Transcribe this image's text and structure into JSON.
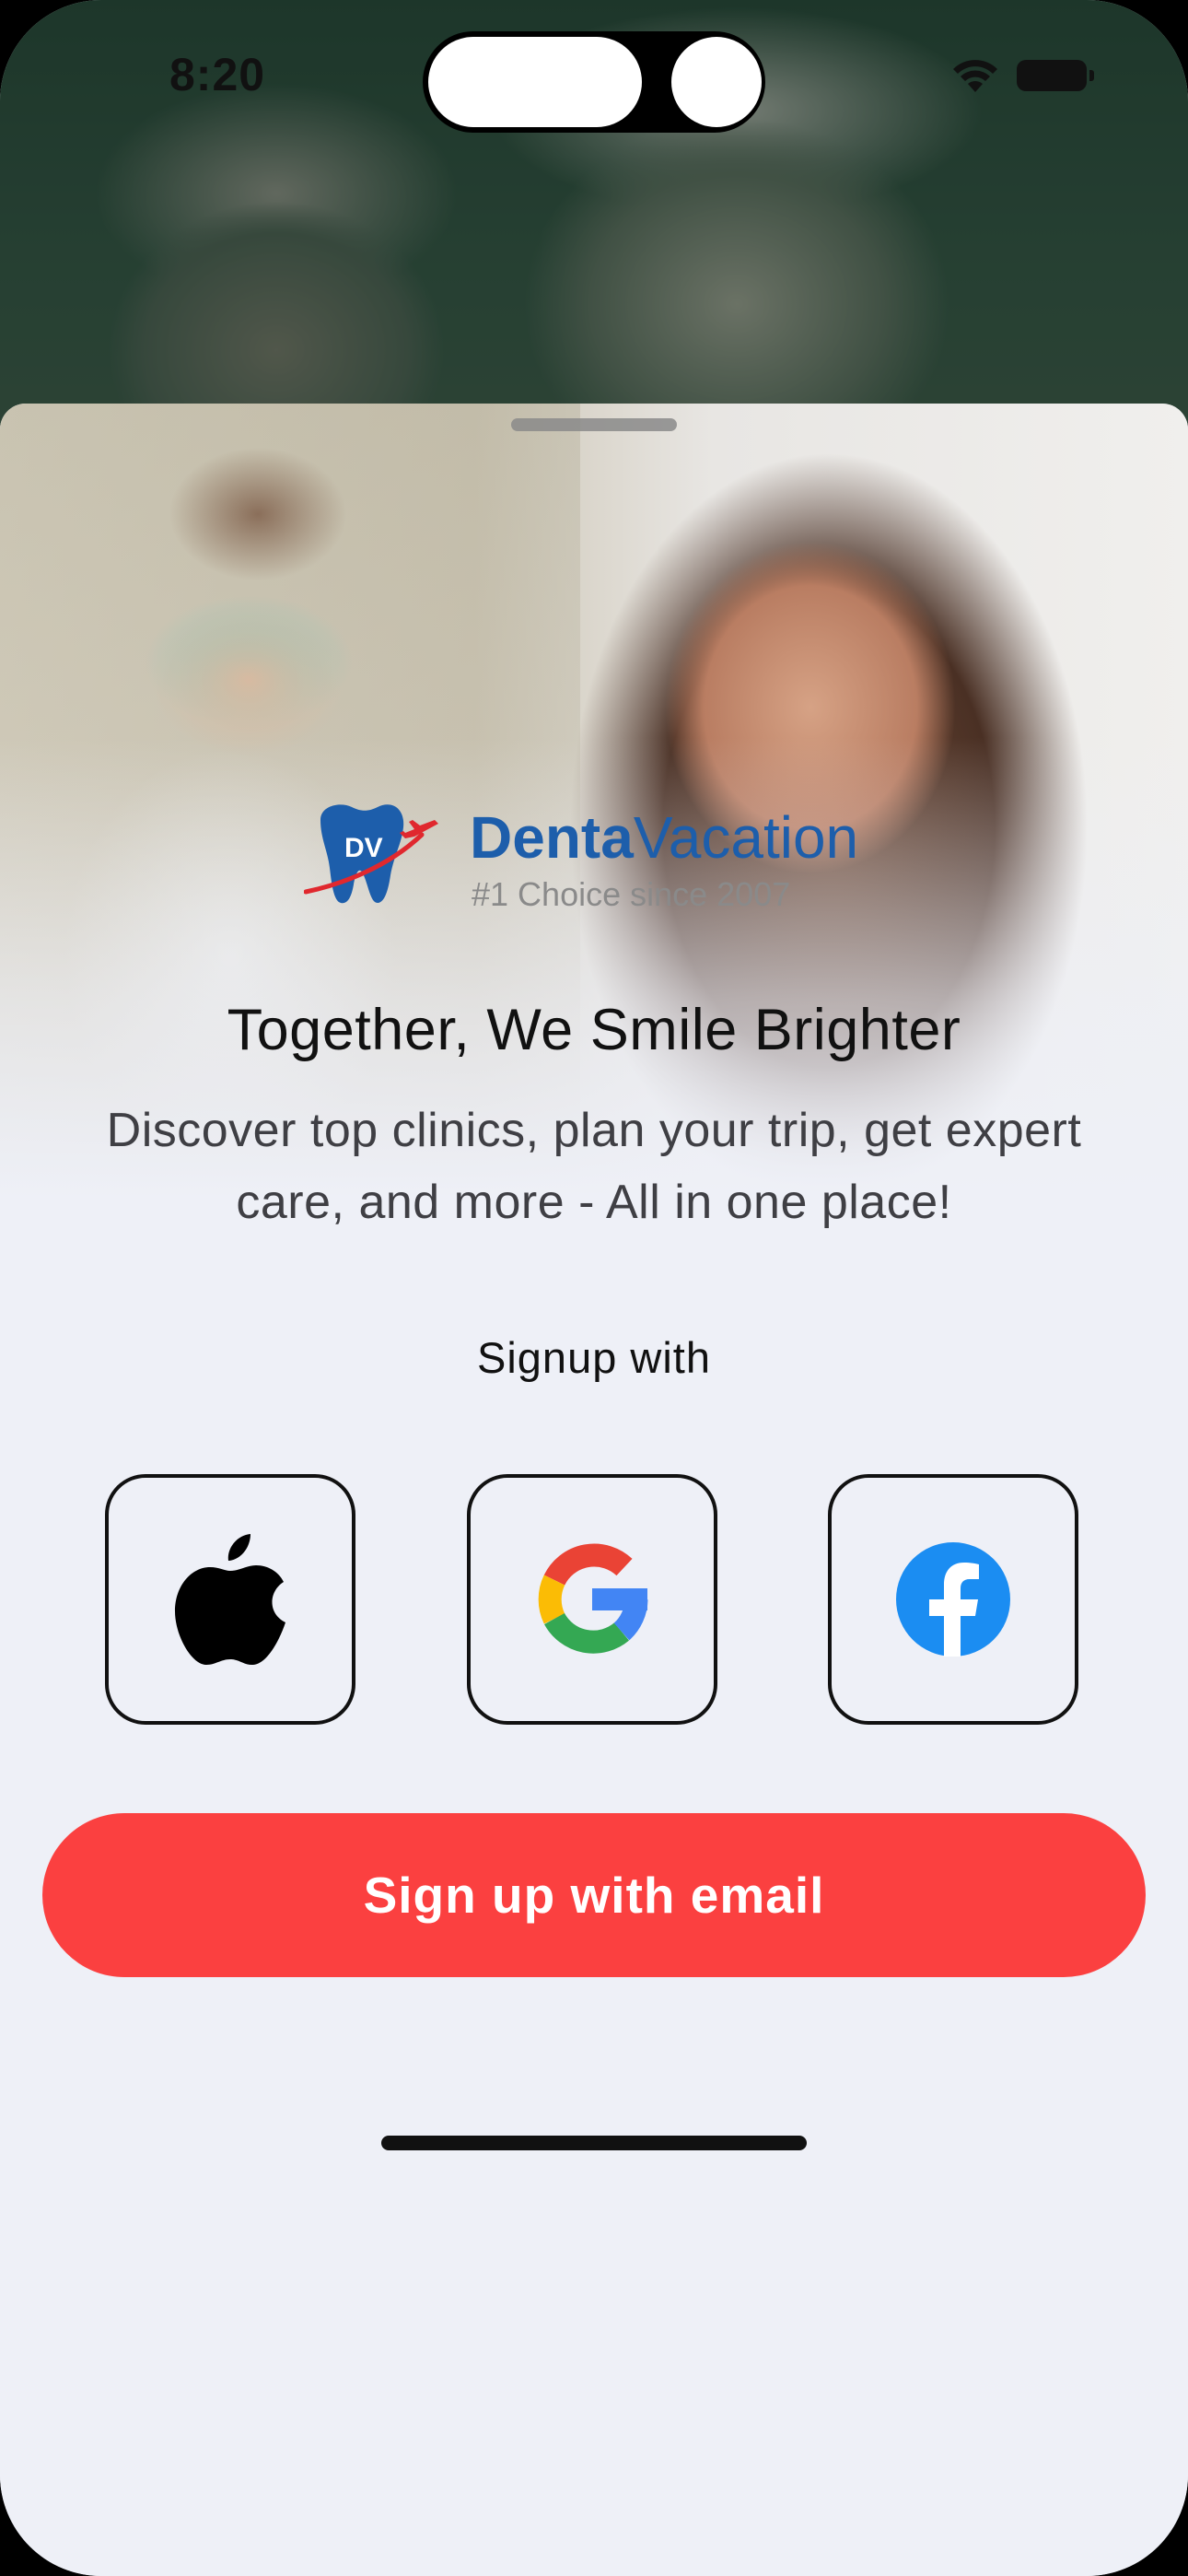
{
  "status_bar": {
    "time": "8:20"
  },
  "brand": {
    "name_bold": "Denta",
    "name_regular": "Vacation",
    "tagline": "#1 Choice since 2007",
    "logo_initials": "DV",
    "color": "#1d5eab"
  },
  "headline": "Together, We Smile Brighter",
  "subtitle_line1": "Discover top clinics, plan your trip, get expert",
  "subtitle_line2": "care, and more - All in one place!",
  "signup_label": "Signup with",
  "social_buttons": [
    {
      "provider": "Apple",
      "icon": "apple-icon"
    },
    {
      "provider": "Google",
      "icon": "google-icon"
    },
    {
      "provider": "Facebook",
      "icon": "facebook-icon"
    }
  ],
  "email_button_label": "Sign up with email",
  "colors": {
    "accent": "#fb4040",
    "background": "#eef0f7",
    "facebook_blue": "#1b8df2"
  }
}
